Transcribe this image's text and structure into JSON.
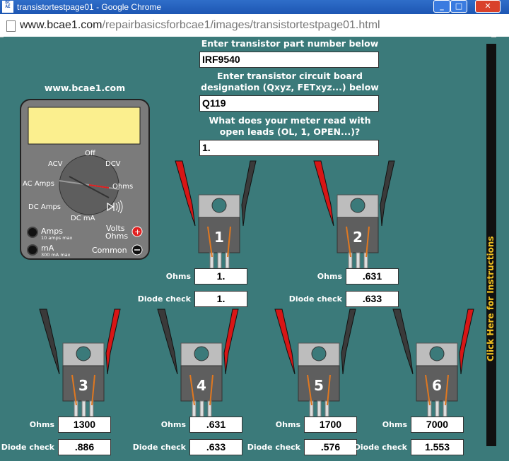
{
  "window": {
    "title": "transistortestpage01 - Google Chrome",
    "app_icon_text": "BCAE",
    "buttons": [
      "_",
      "□",
      "✕"
    ]
  },
  "browser": {
    "url_domain": "www.bcae1.com",
    "url_path": "/repairbasicsforbcae1/images/transistortestpage01.html"
  },
  "site_label": "www.bcae1.com",
  "form": {
    "part_label": "Enter transistor part number below",
    "part_value": "IRF9540",
    "designation_label": "Enter transistor circuit board designation (Qxyz, FETxyz...) below",
    "designation_value": "Q119",
    "open_label": "What does your meter read with open leads (OL, 1, OPEN...)?",
    "open_value": "1."
  },
  "meter": {
    "dial": {
      "off": "Off",
      "acv": "ACV",
      "dcv": "DCV",
      "ac_amps": "AC Amps",
      "ohms": "Ohms",
      "dc_amps": "DC Amps",
      "dc_ma": "DC mA"
    },
    "jacks": {
      "amps": "Amps",
      "amps_sub": "10 amps max",
      "ma": "mA",
      "ma_sub": "300 mA max",
      "volts": "Volts",
      "ohms": "Ohms",
      "common": "Common"
    }
  },
  "labels": {
    "ohms": "Ohms",
    "diode": "Diode check"
  },
  "tests": [
    {
      "num": "1",
      "ohms": "1.",
      "diode": "1."
    },
    {
      "num": "2",
      "ohms": ".631",
      "diode": ".633"
    },
    {
      "num": "3",
      "ohms": "1300",
      "diode": ".886"
    },
    {
      "num": "4",
      "ohms": ".631",
      "diode": ".633"
    },
    {
      "num": "5",
      "ohms": "1700",
      "diode": ".576"
    },
    {
      "num": "6",
      "ohms": "7000",
      "diode": "1.553"
    }
  ],
  "instructions": "Click Here for Instructions",
  "colors": {
    "background": "#3b7a7a",
    "red_lead": "#d81616",
    "black_lead": "#333333",
    "display": "#fbef8e"
  }
}
